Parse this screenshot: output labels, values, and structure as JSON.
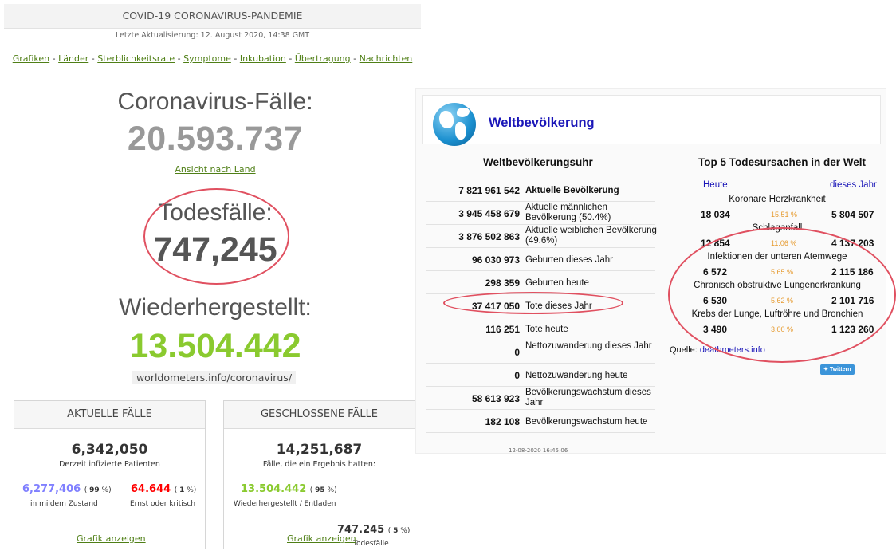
{
  "header": {
    "title": "COVID-19 CORONAVIRUS-PANDEMIE",
    "updated": "Letzte Aktualisierung: 12. August 2020, 14:38 GMT"
  },
  "nav": [
    {
      "label": "Grafiken"
    },
    {
      "label": "Länder"
    },
    {
      "label": "Sterblichkeitsrate"
    },
    {
      "label": "Symptome"
    },
    {
      "label": "Inkubation"
    },
    {
      "label": "Übertragung"
    },
    {
      "label": "Nachrichten"
    }
  ],
  "nav_separator": "-",
  "stats": {
    "cases_label": "Coronavirus-Fälle:",
    "cases_value": "20.593.737",
    "by_country_link": "Ansicht nach Land",
    "deaths_label": "Todesfälle:",
    "deaths_value": "747,245",
    "recovered_label": "Wiederhergestellt:",
    "recovered_value": "13.504.442",
    "source_url": "worldometers.info/coronavirus/"
  },
  "active_cases": {
    "title": "AKTUELLE FÄLLE",
    "total": "6,342,050",
    "total_label": "Derzeit infizierte Patienten",
    "mild_value": "6,277,406",
    "mild_pct": "99",
    "mild_label": "in mildem Zustand",
    "critical_value": "64.644",
    "critical_pct": "1",
    "critical_label": "Ernst oder kritisch",
    "link": "Grafik anzeigen"
  },
  "closed_cases": {
    "title": "GESCHLOSSENE FÄLLE",
    "total": "14,251,687",
    "total_label": "Fälle, die ein Ergebnis hatten:",
    "recovered_value": "13.504.442",
    "recovered_pct": "95",
    "recovered_label": "Wiederhergestellt / Entladen",
    "deaths_value": "747.245",
    "deaths_pct": "5",
    "deaths_label": "Todesfälle",
    "link": "Grafik anzeigen"
  },
  "pct_sign": "%",
  "world": {
    "title": "Weltbevölkerung",
    "clock_title": "Weltbevölkerungsuhr",
    "rows": [
      {
        "value": "7 821 961 542",
        "label": "Aktuelle Bevölkerung"
      },
      {
        "value": "3 945 458 679",
        "label": "Aktuelle männlichen Bevölkerung (50.4%)"
      },
      {
        "value": "3 876 502 863",
        "label": "Aktuelle weiblichen Bevölkerung (49.6%)"
      },
      {
        "value": "96 030 973",
        "label": "Geburten dieses Jahr"
      },
      {
        "value": "298 359",
        "label": "Geburten heute"
      },
      {
        "value": "37 417 050",
        "label": "Tote dieses Jahr"
      },
      {
        "value": "116 251",
        "label": "Tote heute"
      },
      {
        "value": "0",
        "label": "Nettozuwanderung dieses Jahr"
      },
      {
        "value": "0",
        "label": "Nettozuwanderung heute"
      },
      {
        "value": "58 613 923",
        "label": "Bevölkerungswachstum dieses Jahr"
      },
      {
        "value": "182 108",
        "label": "Bevölkerungswachstum heute"
      }
    ],
    "timestamp": "12-08-2020 16:45:06",
    "causes_title": "Top 5 Todesursachen in der Welt",
    "col_today": "Heute",
    "col_year": "dieses Jahr",
    "causes": [
      {
        "name": "Koronare Herzkrankheit",
        "today": "18 034",
        "pct": "15.51 %",
        "year": "5 804 507"
      },
      {
        "name": "Schlaganfall",
        "today": "12 854",
        "pct": "11.06 %",
        "year": "4 137 203"
      },
      {
        "name": "Infektionen der unteren Atemwege",
        "today": "6 572",
        "pct": "5.65 %",
        "year": "2 115 186"
      },
      {
        "name": "Chronisch obstruktive Lungenerkrankung",
        "today": "6 530",
        "pct": "5.62 %",
        "year": "2 101 716"
      },
      {
        "name": "Krebs der Lunge, Luftröhre und Bronchien",
        "today": "3 490",
        "pct": "3.00 %",
        "year": "1 123 260"
      }
    ],
    "source_label": "Quelle:",
    "source_link": "deathmeters.info",
    "twitter": "Twittern"
  },
  "colors": {
    "link_green": "#4f7f16",
    "recovered_green": "#8aca2f",
    "mild_blue": "#8080ff",
    "critical_red": "#ff0000",
    "annotation_red": "#e05060",
    "world_blue": "#1a16b8",
    "pct_orange": "#e69a2e"
  }
}
